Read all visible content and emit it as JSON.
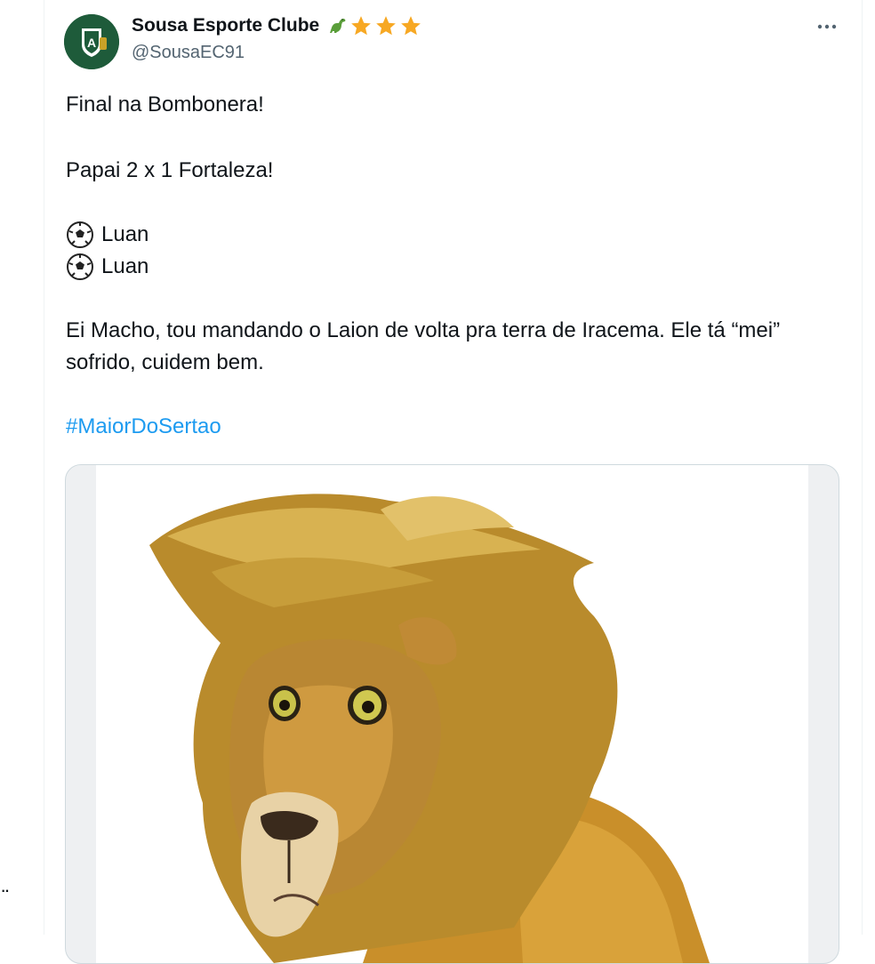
{
  "tweet": {
    "display_name": "Sousa Esporte Clube",
    "handle": "@SousaEC91",
    "badges": [
      "dinosaur-emoji",
      "star-emoji",
      "star-emoji",
      "star-emoji"
    ],
    "more_label": "···",
    "text": {
      "line1": "Final na Bombonera!",
      "line2": "Papai 2 x 1 Fortaleza!",
      "goal1": "Luan",
      "goal2": "Luan",
      "line3": "Ei Macho, tou mandando o Laion de volta pra terra de Iracema. Ele tá “mei” sofrido, cuidem bem.",
      "hashtag": "#MaiorDoSertao"
    },
    "colors": {
      "link": "#1d9bf0",
      "secondary_text": "#536471",
      "avatar_bg": "#1e5b3a"
    }
  },
  "left_gutter": {
    "more_label": "··"
  }
}
